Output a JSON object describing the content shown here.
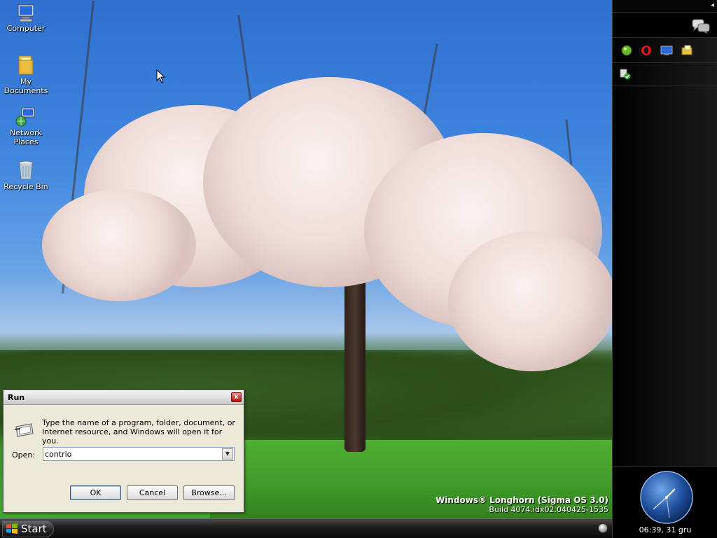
{
  "desktop": {
    "icons": [
      {
        "label": "Computer",
        "icon": "computer-icon"
      },
      {
        "label": "My Documents",
        "icon": "documents-folder-icon"
      },
      {
        "label": "Network Places",
        "icon": "network-places-icon"
      },
      {
        "label": "Recycle Bin",
        "icon": "recycle-bin-icon"
      }
    ],
    "watermark": {
      "line1": "Windows® Longhorn (Sigma OS 3.0)",
      "line2": "Build 4074.idx02.040425-1535"
    }
  },
  "run_dialog": {
    "title": "Run",
    "close_label": "x",
    "description": "Type the name of a program, folder, document, or Internet resource, and Windows will open it for you.",
    "open_label": "Open:",
    "open_value": "contrio",
    "ok_label": "OK",
    "cancel_label": "Cancel",
    "browse_label": "Browse..."
  },
  "taskbar": {
    "start_label": "Start"
  },
  "sidebar": {
    "top_arrow": "◂",
    "quick_icons": [
      "green-orb-icon",
      "opera-icon",
      "desktop-icon",
      "folder-note-icon"
    ],
    "tray_icons": [
      "shield-check-icon"
    ],
    "clock_text": "06:39, 31 gru"
  },
  "colors": {
    "sidebar_bg": "#000000",
    "dialog_bg": "#ece9d8",
    "sky": "#3f86df",
    "grass": "#46a52c"
  }
}
